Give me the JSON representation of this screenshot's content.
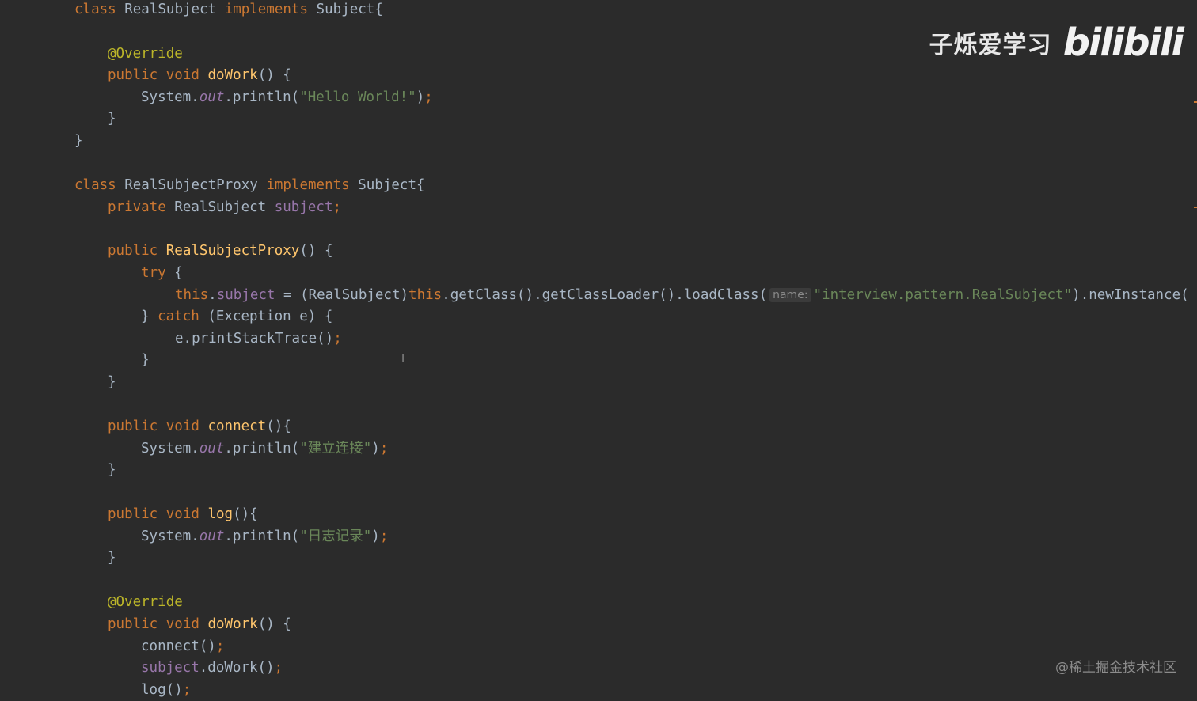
{
  "code": {
    "l1_class": "class",
    "l1_name": " RealSubject ",
    "l1_impl": "implements",
    "l1_iface": " Subject{",
    "l2_anno": "@Override",
    "l3_public": "public",
    "l3_void": "void",
    "l3_fn": "doWork",
    "l3_rest": "() {",
    "l4_sys": "System.",
    "l4_out": "out",
    "l4_call": ".println(",
    "l4_str": "\"Hello World!\"",
    "l4_end": ")",
    "l4_semi": ";",
    "close": "}",
    "l7_class": "class",
    "l7_name": " RealSubjectProxy ",
    "l7_impl": "implements",
    "l7_iface": " Subject{",
    "l8_private": "private",
    "l8_type": " RealSubject ",
    "l8_field": "subject",
    "l8_semi": ";",
    "l9_public": "public",
    "l9_fn": "RealSubjectProxy",
    "l9_rest": "() {",
    "l10_try": "try",
    "l10_rest": " {",
    "l11_this": "this",
    "l11_dot": ".",
    "l11_field": "subject",
    "l11_assign": " = (RealSubject)",
    "l11_this2": "this",
    "l11_chain": ".getClass().getClassLoader().loadClass(",
    "l11_hint": "name:",
    "l11_str": "\"interview.pattern.RealSubject\"",
    "l11_tail": ").newInstance(",
    "l12_open": "} ",
    "l12_catch": "catch",
    "l12_rest": " (Exception e) {",
    "l13_call": "e.printStackTrace()",
    "l13_semi": ";",
    "l14_public": "public",
    "l14_void": "void",
    "l14_fn": "connect",
    "l14_rest": "(){",
    "l15_str": "\"建立连接\"",
    "l16_fn": "log",
    "l17_str": "\"日志记录\"",
    "l18_anno": "@Override",
    "l19_fn": "doWork",
    "l19_rest": "() {",
    "l20_call": "connect()",
    "l21_field": "subject",
    "l21_call": ".doWork()",
    "l22_call": "log()"
  },
  "watermark": {
    "channel": "子烁爱学习",
    "logo": "bilibili"
  },
  "credit": "@稀土掘金技术社区",
  "colors": {
    "background": "#2b2b2b",
    "keyword": "#cc7832",
    "function": "#ffc66d",
    "string": "#6a8759",
    "field": "#9876aa",
    "annotation": "#bbb529",
    "text": "#a9b7c6"
  }
}
